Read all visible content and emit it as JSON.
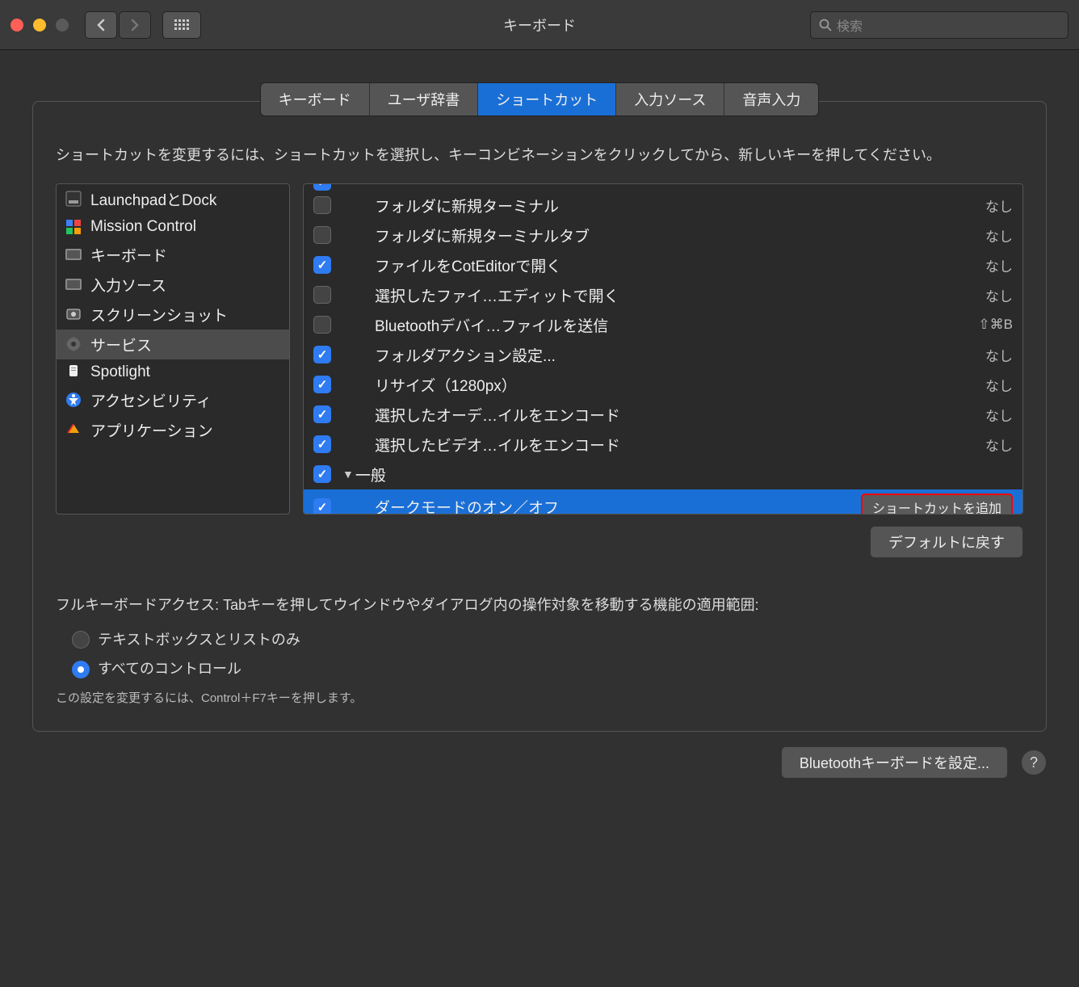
{
  "window": {
    "title": "キーボード",
    "search_placeholder": "検索"
  },
  "tabs": [
    {
      "label": "キーボード"
    },
    {
      "label": "ユーザ辞書"
    },
    {
      "label": "ショートカット"
    },
    {
      "label": "入力ソース"
    },
    {
      "label": "音声入力"
    }
  ],
  "instructions": "ショートカットを変更するには、ショートカットを選択し、キーコンビネーションをクリックしてから、新しいキーを押してください。",
  "categories": [
    {
      "label": "LaunchpadとDock",
      "icon": "launchpad"
    },
    {
      "label": "Mission Control",
      "icon": "mission-control"
    },
    {
      "label": "キーボード",
      "icon": "keyboard"
    },
    {
      "label": "入力ソース",
      "icon": "keyboard"
    },
    {
      "label": "スクリーンショット",
      "icon": "screenshot"
    },
    {
      "label": "サービス",
      "icon": "gear",
      "selected": true
    },
    {
      "label": "Spotlight",
      "icon": "spotlight"
    },
    {
      "label": "アクセシビリティ",
      "icon": "accessibility"
    },
    {
      "label": "アプリケーション",
      "icon": "app"
    }
  ],
  "shortcuts": [
    {
      "checked": false,
      "label": "フォルダに新規ターミナル",
      "value": "なし"
    },
    {
      "checked": false,
      "label": "フォルダに新規ターミナルタブ",
      "value": "なし"
    },
    {
      "checked": true,
      "label": "ファイルをCotEditorで開く",
      "value": "なし"
    },
    {
      "checked": false,
      "label": "選択したファイ…エディットで開く",
      "value": "なし"
    },
    {
      "checked": false,
      "label": "Bluetoothデバイ…ファイルを送信",
      "value": "⇧⌘B"
    },
    {
      "checked": true,
      "label": "フォルダアクション設定...",
      "value": "なし"
    },
    {
      "checked": true,
      "label": "リサイズ（1280px）",
      "value": "なし"
    },
    {
      "checked": true,
      "label": "選択したオーデ…イルをエンコード",
      "value": "なし"
    },
    {
      "checked": true,
      "label": "選択したビデオ…イルをエンコード",
      "value": "なし"
    },
    {
      "group": true,
      "checked": true,
      "label": "一般"
    },
    {
      "checked": true,
      "label": "ダークモードのオン／オフ",
      "highlighted": true,
      "button": "ショートカットを追加"
    }
  ],
  "restore_defaults": "デフォルトに戻す",
  "keyboard_access": {
    "label": "フルキーボードアクセス: Tabキーを押してウインドウやダイアログ内の操作対象を移動する機能の適用範囲:",
    "options": [
      {
        "label": "テキストボックスとリストのみ",
        "checked": false
      },
      {
        "label": "すべてのコントロール",
        "checked": true
      }
    ],
    "footnote": "この設定を変更するには、Control＋F7キーを押します。"
  },
  "footer": {
    "bluetooth_button": "Bluetoothキーボードを設定..."
  }
}
